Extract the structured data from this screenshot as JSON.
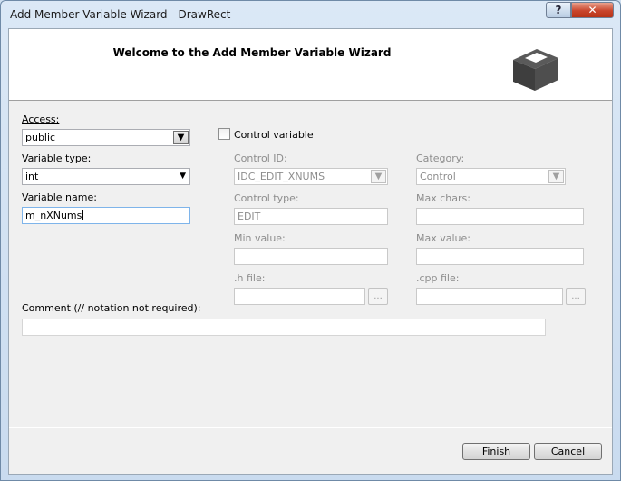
{
  "window": {
    "title": "Add Member Variable Wizard - DrawRect",
    "help_glyph": "?",
    "close_glyph": "✕"
  },
  "banner": {
    "title": "Welcome to the Add Member Variable Wizard",
    "icon": "3d-box-icon"
  },
  "access": {
    "label": "Access:",
    "value": "public"
  },
  "control_variable": {
    "label": "Control variable",
    "checked": false
  },
  "variable_type": {
    "label": "Variable type:",
    "value": "int"
  },
  "variable_name": {
    "label": "Variable name:",
    "value": "m_nXNums"
  },
  "control_id": {
    "label": "Control ID:",
    "value": "IDC_EDIT_XNUMS"
  },
  "category": {
    "label": "Category:",
    "value": "Control"
  },
  "control_type": {
    "label": "Control type:",
    "value": "EDIT"
  },
  "max_chars": {
    "label": "Max chars:",
    "value": ""
  },
  "min_value": {
    "label": "Min value:",
    "value": ""
  },
  "max_value": {
    "label": "Max value:",
    "value": ""
  },
  "h_file": {
    "label": ".h file:",
    "value": "",
    "browse_label": "..."
  },
  "cpp_file": {
    "label": ".cpp file:",
    "value": "",
    "browse_label": "..."
  },
  "comment": {
    "label": "Comment (// notation not required):",
    "value": ""
  },
  "buttons": {
    "finish": "Finish",
    "cancel": "Cancel"
  },
  "colors": {
    "close_button": "#c9452c",
    "disabled_text": "#8d8d8d",
    "dialog_background": "#f0f0f0"
  }
}
